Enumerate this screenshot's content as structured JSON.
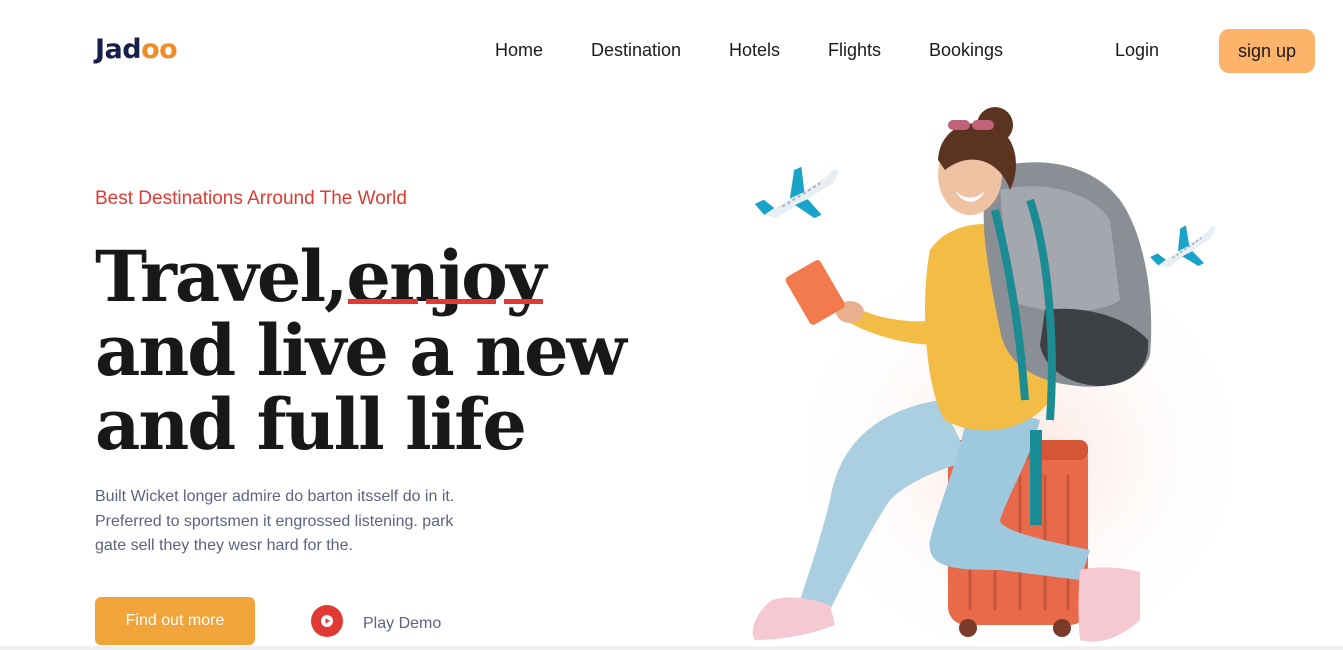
{
  "brand": {
    "name_prefix": "Jad",
    "name_suffix": "oo",
    "accent_color": "#f28c28"
  },
  "nav": {
    "items": [
      "Home",
      "Destination",
      "Hotels",
      "Flights",
      "Bookings"
    ],
    "login": "Login",
    "signup": "sign up"
  },
  "hero": {
    "eyebrow": "Best Destinations Arround The World",
    "headline_line1_a": "Travel,",
    "headline_line1_b": "enjoy",
    "headline_line2": "and live a new",
    "headline_line3": "and full life",
    "description": "Built Wicket longer admire do barton itsself do in it. Preferred to sportsmen it engrossed listening. park gate sell they they wesr hard for the.",
    "cta_label": "Find out more",
    "play_label": "Play Demo"
  },
  "icons": {
    "play": "play-icon",
    "plane": "plane-icon"
  },
  "colors": {
    "primary_red": "#df3a33",
    "cta_orange": "#f1a43a",
    "signup_bg": "#fdb36a",
    "text_muted": "#5e6282"
  }
}
